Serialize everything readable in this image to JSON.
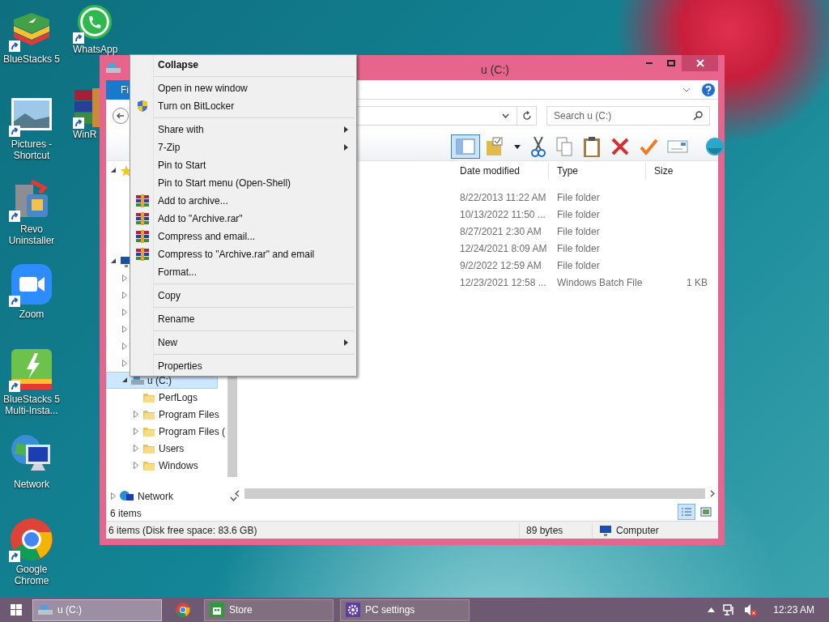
{
  "icon_columns": [
    [
      {
        "label": "BlueStacks 5",
        "kind": "bluestacks",
        "shortcut": true
      },
      {
        "label": "Pictures - Shortcut",
        "kind": "pictures",
        "shortcut": true
      },
      {
        "label": "Revo Uninstaller",
        "kind": "revo",
        "shortcut": true
      },
      {
        "label": "Zoom",
        "kind": "zoom",
        "shortcut": true
      },
      {
        "label": "BlueStacks 5 Multi-Insta...",
        "kind": "multi",
        "shortcut": true
      },
      {
        "label": "Network",
        "kind": "network",
        "shortcut": false
      },
      {
        "label": "Google Chrome",
        "kind": "chrome",
        "shortcut": true
      }
    ],
    [
      {
        "label": "WhatsApp",
        "kind": "whatsapp",
        "shortcut": true
      },
      {
        "label": "WinR",
        "kind": "winrar",
        "shortcut": true
      }
    ]
  ],
  "window": {
    "title": "u (C:)",
    "ribbon_tab": "Fi",
    "search": {
      "placeholder": "Search u (C:)"
    },
    "navigation_pane_on": true,
    "toolbar": [
      {
        "kind": "pane"
      },
      {
        "kind": "folder"
      },
      {
        "kind": "caret"
      },
      {
        "kind": "cut"
      },
      {
        "kind": "copy"
      },
      {
        "kind": "paste"
      },
      {
        "kind": "delete"
      },
      {
        "kind": "check"
      },
      {
        "kind": "rename"
      },
      {
        "kind": "shell"
      }
    ],
    "tree": [
      {
        "kind": "favorites",
        "expanded": true,
        "selected": false
      },
      {
        "kind": "computer",
        "expanded": true,
        "selected": false,
        "children": [
          {
            "kind": "hidden",
            "expanded": false,
            "selected": false
          },
          {
            "kind": "hidden",
            "expanded": false,
            "selected": false
          },
          {
            "kind": "hidden",
            "expanded": false,
            "selected": false
          },
          {
            "kind": "hidden",
            "expanded": false,
            "selected": false
          },
          {
            "kind": "hidden",
            "expanded": false,
            "selected": false
          },
          {
            "kind": "hidden",
            "expanded": false,
            "selected": false
          },
          {
            "label": "u (C:)",
            "kind": "drive",
            "expanded": true,
            "selected": true,
            "children": [
              {
                "label": "PerfLogs",
                "kind": "folder",
                "leaf": true,
                "selected": false
              },
              {
                "label": "Program Files",
                "kind": "folder",
                "expanded": false,
                "selected": false
              },
              {
                "label": "Program Files (",
                "kind": "folder",
                "expanded": false,
                "selected": false
              },
              {
                "label": "Users",
                "kind": "folder",
                "expanded": false,
                "selected": false
              },
              {
                "label": "Windows",
                "kind": "folder",
                "expanded": false,
                "selected": false
              }
            ]
          }
        ]
      },
      {
        "label": "Network",
        "kind": "network",
        "expanded": false,
        "selected": false
      }
    ],
    "columns": [
      "Date modified",
      "Type",
      "Size"
    ],
    "rows": [
      {
        "date": "8/22/2013 11:22 AM",
        "type": "File folder"
      },
      {
        "date": "10/13/2022 11:50 ...",
        "type": "File folder"
      },
      {
        "date": "8/27/2021 2:30 AM",
        "type": "File folder"
      },
      {
        "date": "12/24/2021 8:09 AM",
        "type": "File folder"
      },
      {
        "date": "9/2/2022 12:59 AM",
        "type": "File folder"
      },
      {
        "date": "12/23/2021 12:58 ...",
        "type": "Windows Batch File",
        "size": "1 KB"
      }
    ],
    "item_count": "6 items",
    "views": [
      {
        "kind": "details",
        "selected": true
      },
      {
        "kind": "thumbnails",
        "selected": false
      }
    ],
    "status_bar": {
      "summary": "6 items (Disk free space: 83.6 GB)",
      "size": "89 bytes",
      "location": "Computer"
    }
  },
  "context_menu": [
    {
      "kind": "header",
      "label": "Collapse"
    },
    {
      "kind": "separator"
    },
    {
      "kind": "item",
      "label": "Open in new window"
    },
    {
      "kind": "shield",
      "label": "Turn on BitLocker"
    },
    {
      "kind": "separator"
    },
    {
      "kind": "item",
      "label": "Share with",
      "submenu": true
    },
    {
      "kind": "item",
      "label": "7-Zip",
      "submenu": true
    },
    {
      "kind": "item",
      "label": "Pin to Start"
    },
    {
      "kind": "item",
      "label": "Pin to Start menu (Open-Shell)"
    },
    {
      "kind": "archive",
      "label": "Add to archive..."
    },
    {
      "kind": "archive",
      "label": "Add to \"Archive.rar\""
    },
    {
      "kind": "archive",
      "label": "Compress and email..."
    },
    {
      "kind": "archive",
      "label": "Compress to \"Archive.rar\" and email"
    },
    {
      "kind": "item",
      "label": "Format..."
    },
    {
      "kind": "separator"
    },
    {
      "kind": "item",
      "label": "Copy"
    },
    {
      "kind": "separator"
    },
    {
      "kind": "item",
      "label": "Rename"
    },
    {
      "kind": "separator"
    },
    {
      "kind": "item",
      "label": "New",
      "submenu": true
    },
    {
      "kind": "separator"
    },
    {
      "kind": "item",
      "label": "Properties"
    }
  ],
  "taskbar": {
    "items": [
      {
        "kind": "explorer",
        "label": "u (C:)",
        "active": true
      },
      {
        "kind": "chrome",
        "active": false
      },
      {
        "kind": "store",
        "label": "Store",
        "active": false
      },
      {
        "kind": "settings",
        "label": "PC settings",
        "active": false
      }
    ],
    "clock": "12:23 AM"
  }
}
